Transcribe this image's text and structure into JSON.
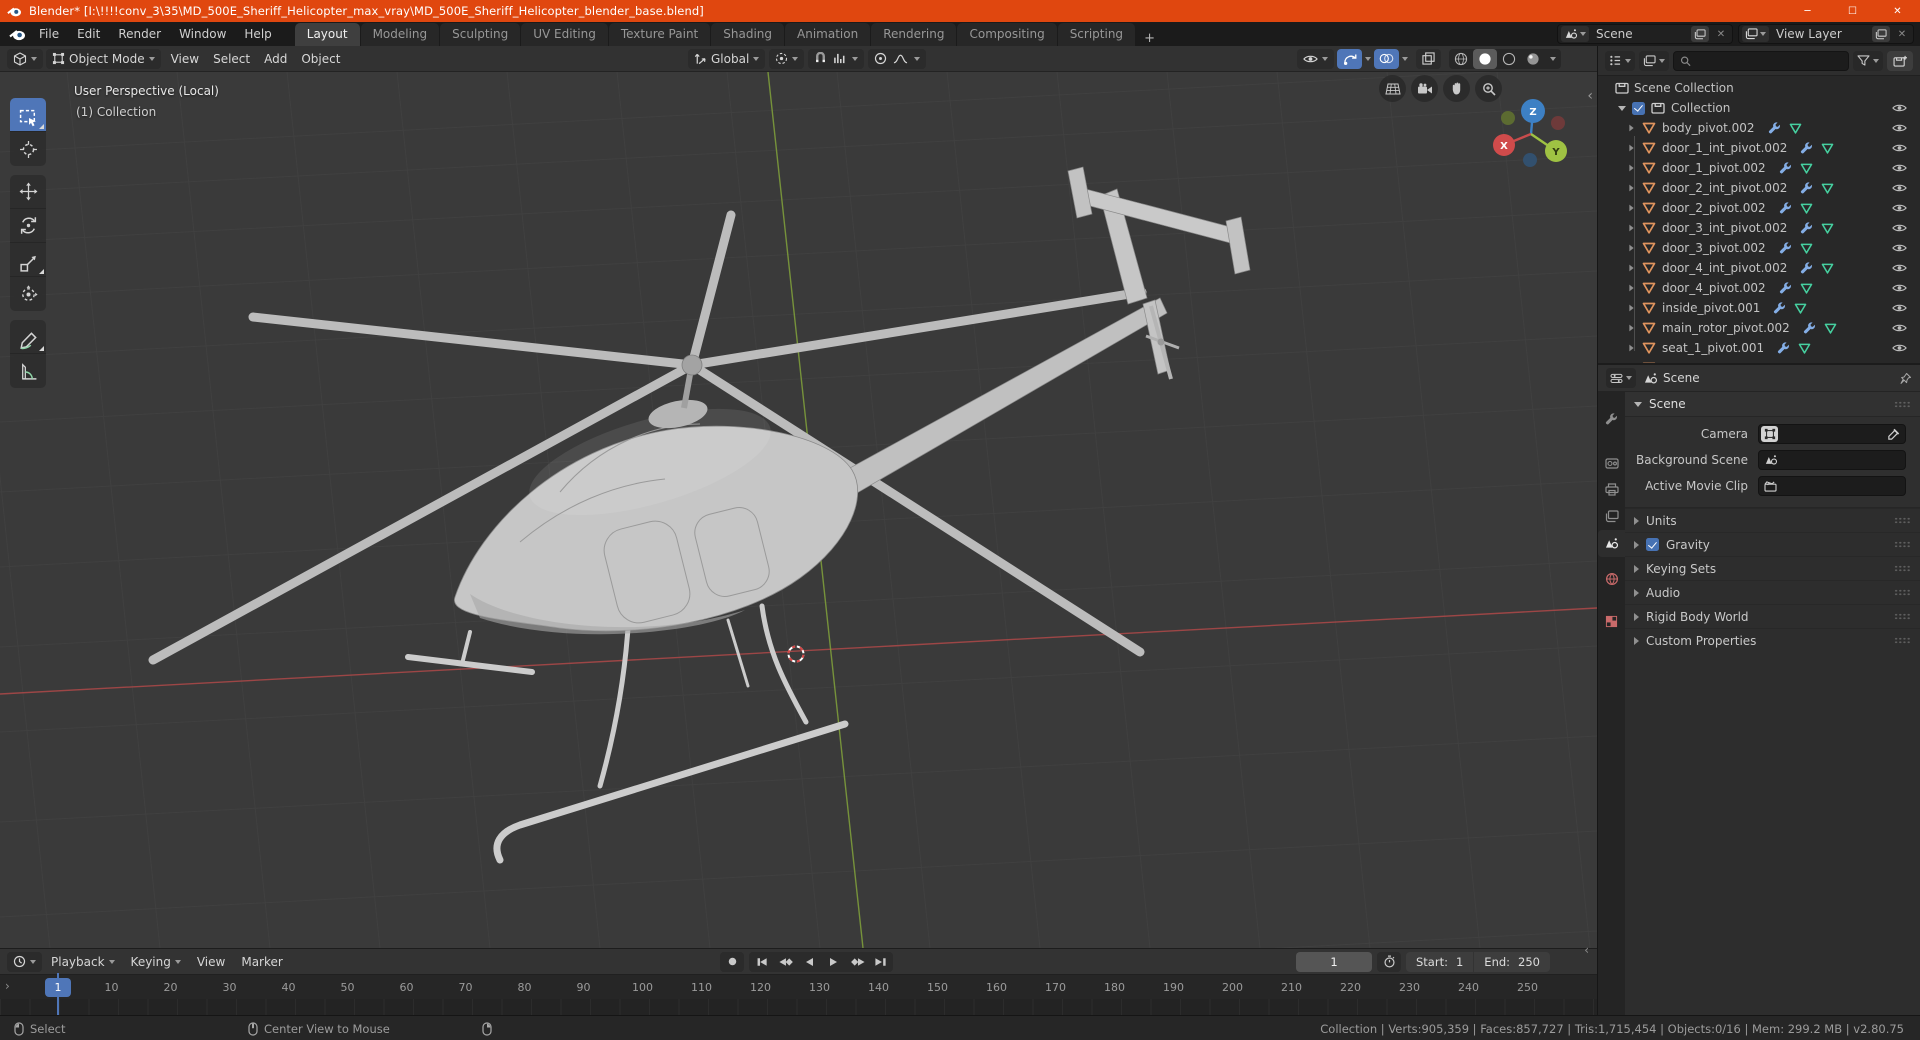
{
  "titlebar": {
    "title": "Blender* [I:\\!!!!conv_3\\35\\MD_500E_Sheriff_Helicopter_max_vray\\MD_500E_Sheriff_Helicopter_blender_base.blend]",
    "minimize": "─",
    "maximize": "☐",
    "close": "✕"
  },
  "topbar": {
    "menus": [
      "File",
      "Edit",
      "Render",
      "Window",
      "Help"
    ],
    "active_workspace": "Layout",
    "other_workspaces": [
      "Modeling",
      "Sculpting",
      "UV Editing",
      "Texture Paint",
      "Shading",
      "Animation",
      "Rendering",
      "Compositing",
      "Scripting"
    ],
    "add_workspace": "+",
    "scene_selector": {
      "value": "Scene"
    },
    "view_layer_selector": {
      "value": "View Layer"
    }
  },
  "viewport": {
    "header": {
      "mode": "Object Mode",
      "menus": [
        "View",
        "Select",
        "Add",
        "Object"
      ],
      "orientation": "Global"
    },
    "overlay": {
      "line1": "User Perspective (Local)",
      "line2": "(1) Collection"
    },
    "gizmo_axes": {
      "x": "X",
      "y": "Y",
      "z": "Z"
    }
  },
  "outliner": {
    "scene_collection": "Scene Collection",
    "collection": "Collection",
    "objects": [
      "body_pivot.002",
      "door_1_int_pivot.002",
      "door_1_pivot.002",
      "door_2_int_pivot.002",
      "door_2_pivot.002",
      "door_3_int_pivot.002",
      "door_3_pivot.002",
      "door_4_int_pivot.002",
      "door_4_pivot.002",
      "inside_pivot.001",
      "main_rotor_pivot.002",
      "seat_1_pivot.001"
    ]
  },
  "properties": {
    "breadcrumb": "Scene",
    "scene_panel": {
      "title": "Scene",
      "camera_label": "Camera",
      "background_scene_label": "Background Scene",
      "active_movie_clip_label": "Active Movie Clip"
    },
    "panels": {
      "units": "Units",
      "gravity": "Gravity",
      "keying_sets": "Keying Sets",
      "audio": "Audio",
      "rigid_body_world": "Rigid Body World",
      "custom_properties": "Custom Properties"
    }
  },
  "timeline": {
    "menu_playback": "Playback",
    "menu_keying": "Keying",
    "menu_view": "View",
    "menu_marker": "Marker",
    "current_frame": "1",
    "frame_field": "1",
    "start_label": "Start:",
    "start_value": "1",
    "end_label": "End:",
    "end_value": "250",
    "ticks": [
      "10",
      "20",
      "30",
      "40",
      "50",
      "60",
      "70",
      "80",
      "90",
      "100",
      "110",
      "120",
      "130",
      "140",
      "150",
      "160",
      "170",
      "180",
      "190",
      "200",
      "210",
      "220",
      "230",
      "240",
      "250"
    ]
  },
  "statusbar": {
    "left_hint": "Select",
    "middle_hint": "Center View to Mouse",
    "stats": "Collection | Verts:905,359 | Faces:857,727 | Tris:1,715,454 | Objects:0/16 | Mem: 299.2 MB | v2.80.75"
  },
  "icons": {
    "blender-logo": "orange orb with white swirl",
    "search": "magnifier",
    "filter": "funnel",
    "eye": "visibility eye",
    "wrench": "modifier wrench",
    "mesh-triangle": "triangle outline",
    "collection-box": "archive box",
    "magnet": "snap magnet",
    "stopwatch": "auto-key stopwatch",
    "clock": "timeline clock",
    "pin": "pushpin",
    "eyedropper": "data picker",
    "record": "●",
    "chevron": "▾"
  },
  "colors": {
    "titlebar": "#e0470f",
    "accent": "#4f76b8",
    "checkbox": "#4772b3",
    "object_orange": "#e0945e",
    "data_green": "#46d0a0",
    "modifier_blue": "#84aee6"
  }
}
